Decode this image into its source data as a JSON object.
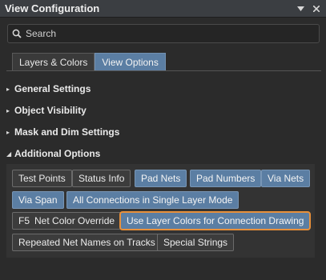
{
  "panel": {
    "title": "View Configuration",
    "menu_glyph": "▾",
    "close_glyph": "✕"
  },
  "search": {
    "placeholder": "Search"
  },
  "tabs": [
    {
      "label": "Layers & Colors",
      "active": false
    },
    {
      "label": "View Options",
      "active": true
    }
  ],
  "sections": [
    {
      "label": "General Settings",
      "arrow": "▸",
      "expanded": false
    },
    {
      "label": "Object Visibility",
      "arrow": "▸",
      "expanded": false
    },
    {
      "label": "Mask and Dim Settings",
      "arrow": "▸",
      "expanded": false
    },
    {
      "label": "Additional Options",
      "arrow": "◢",
      "expanded": true
    }
  ],
  "additional_options": {
    "buttons": [
      {
        "label": "Test Points",
        "on": false
      },
      {
        "label": "Status Info",
        "on": false
      },
      {
        "label": "Pad Nets",
        "on": true
      },
      {
        "label": "Pad Numbers",
        "on": true
      },
      {
        "label": "Via Nets",
        "on": true
      },
      {
        "label": "Via Span",
        "on": true
      },
      {
        "label": "All Connections in Single Layer Mode",
        "on": true
      },
      {
        "label": "Net Color Override",
        "shortcut": "F5",
        "on": false
      },
      {
        "label": "Use Layer Colors for Connection Drawing",
        "on": true,
        "highlighted": true
      },
      {
        "label": "Repeated Net Names on Tracks",
        "on": false
      },
      {
        "label": "Special Strings",
        "on": false
      }
    ]
  },
  "colors": {
    "accent": "#5b7ea3",
    "highlight_border": "#e8903a",
    "background": "#2b2b2b"
  }
}
